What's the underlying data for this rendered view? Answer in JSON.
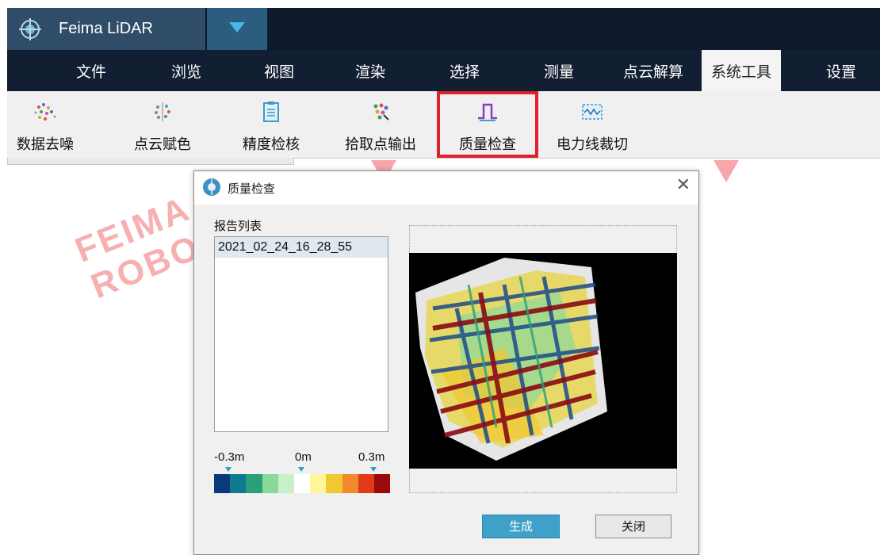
{
  "app": {
    "title": "Feima LiDAR"
  },
  "menu": {
    "items": [
      {
        "label": "文件"
      },
      {
        "label": "浏览"
      },
      {
        "label": "视图"
      },
      {
        "label": "渲染"
      },
      {
        "label": "选择"
      },
      {
        "label": "测量"
      },
      {
        "label": "点云解算"
      },
      {
        "label": "系统工具",
        "active": true
      },
      {
        "label": "设置"
      }
    ]
  },
  "toolbar": {
    "tools": [
      {
        "label": "数据去噪",
        "icon": "denoise-icon"
      },
      {
        "label": "点云赋色",
        "icon": "colorize-icon"
      },
      {
        "label": "精度检核",
        "icon": "clipboard-icon"
      },
      {
        "label": "拾取点输出",
        "icon": "pick-points-icon"
      },
      {
        "label": "质量检查",
        "icon": "pulse-icon",
        "highlighted": true
      },
      {
        "label": "电力线裁切",
        "icon": "powerline-icon"
      }
    ]
  },
  "watermark": {
    "line1": "FEIMA",
    "line2": "ROBO"
  },
  "dialog": {
    "title": "质量检查",
    "close_glyph": "✕",
    "report_list_label": "报告列表",
    "reports": [
      "2021_02_24_16_28_55"
    ],
    "scale": {
      "min": "-0.3m",
      "mid": "0m",
      "max": "0.3m"
    },
    "colorbar": [
      "#0b3a7a",
      "#0e7a8c",
      "#2aa07a",
      "#8ad89a",
      "#c8f0c8",
      "#ffffff",
      "#fff59a",
      "#f2c830",
      "#f08a2a",
      "#e03a1a",
      "#9a0a0a"
    ],
    "buttons": {
      "generate": "生成",
      "close": "关闭"
    }
  },
  "colors": {
    "accent": "#3fa1c9",
    "highlight": "#e0202a",
    "menubar": "#121e31"
  }
}
